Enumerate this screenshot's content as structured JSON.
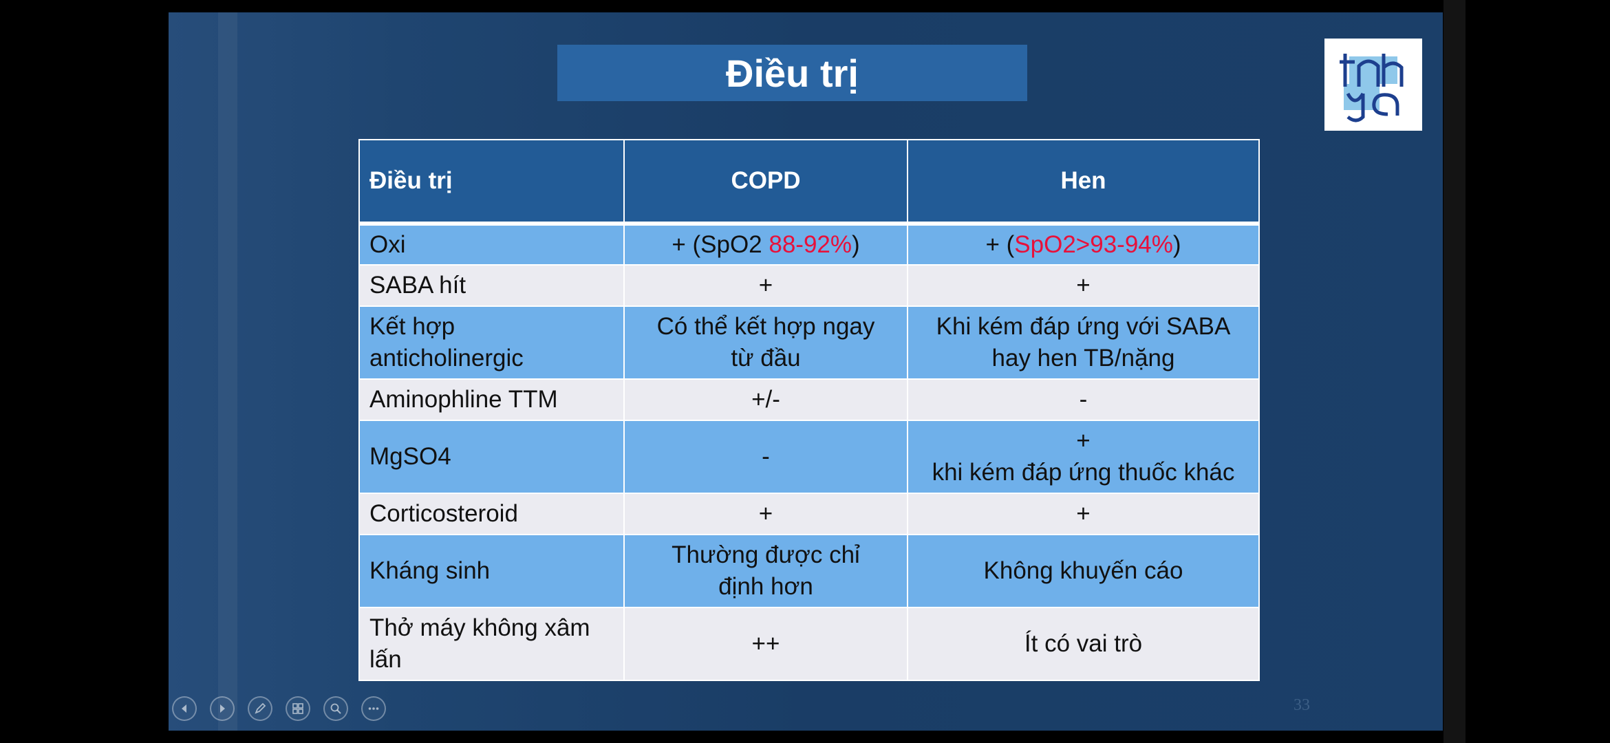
{
  "slide": {
    "title": "Điều trị",
    "page_number": "33"
  },
  "table": {
    "headers": [
      "Điều trị",
      "COPD",
      "Hen"
    ],
    "rows": [
      {
        "label": "Oxi",
        "copd_pre": "+  (SpO2 ",
        "copd_hl": "88-92%",
        "copd_post": ")",
        "hen_pre": "+ (",
        "hen_hl": "SpO2>93-94%",
        "hen_post": ")"
      },
      {
        "label": "SABA hít",
        "copd": "+",
        "hen": "+"
      },
      {
        "label_l1": "Kết hợp",
        "label_l2": "anticholinergic",
        "copd_l1": "Có thể kết hợp ngay",
        "copd_l2": "từ đầu",
        "hen_l1": "Khi kém đáp ứng với SABA",
        "hen_l2": "hay hen TB/nặng"
      },
      {
        "label": "Aminophline TTM",
        "copd": "+/-",
        "hen": "-"
      },
      {
        "label": "MgSO4",
        "copd": "-",
        "hen_l1": "+",
        "hen_l2": "khi kém đáp ứng thuốc khác"
      },
      {
        "label": "Corticosteroid",
        "copd": "+",
        "hen": "+"
      },
      {
        "label": "Kháng sinh",
        "copd_l1": "Thường được chỉ",
        "copd_l2": "định hơn",
        "hen": "Không khuyến cáo"
      },
      {
        "label_l1": "Thở máy không xâm",
        "label_l2": "lấn",
        "copd": "++",
        "hen": "Ít có vai trò"
      }
    ]
  },
  "colors": {
    "header_bg": "#225b96",
    "row_blue": "#6fb0ea",
    "row_light": "#ebebf1",
    "highlight_text": "#e8103a",
    "title_bg": "#2a65a3"
  },
  "toolbar": {
    "icons": [
      "previous-icon",
      "next-icon",
      "pen-icon",
      "slides-grid-icon",
      "zoom-icon",
      "more-icon"
    ]
  }
}
